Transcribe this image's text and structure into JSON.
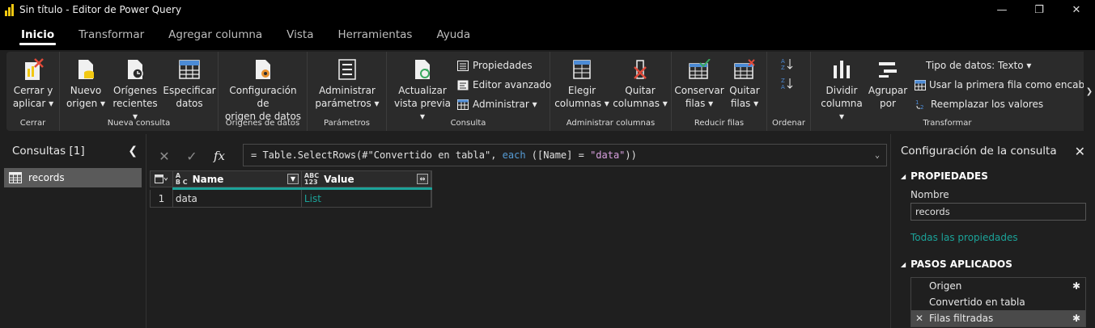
{
  "window": {
    "title": "Sin título - Editor de Power Query",
    "minimize": "—",
    "maximize": "❐",
    "close": "✕"
  },
  "tabs": [
    "Inicio",
    "Transformar",
    "Agregar columna",
    "Vista",
    "Herramientas",
    "Ayuda"
  ],
  "ribbon": {
    "cerrar": {
      "label": "Cerrar y\naplicar ▾",
      "group": "Cerrar"
    },
    "nueva_consulta": {
      "nuevo_origen": "Nuevo\norigen ▾",
      "origenes_recientes": "Orígenes\nrecientes ▾",
      "especificar_datos": "Especificar\ndatos",
      "group": "Nueva consulta"
    },
    "origenes": {
      "config": "Configuración de\norigen de datos",
      "group": "Orígenes de datos"
    },
    "parametros": {
      "admin": "Administrar\nparámetros ▾",
      "group": "Parámetros"
    },
    "consulta": {
      "actualizar": "Actualizar\nvista previa ▾",
      "propiedades": "Propiedades",
      "editor_avanzado": "Editor avanzado",
      "administrar": "Administrar ▾",
      "group": "Consulta"
    },
    "admin_columnas": {
      "elegir": "Elegir\ncolumnas ▾",
      "quitar": "Quitar\ncolumnas ▾",
      "group": "Administrar columnas"
    },
    "reducir_filas": {
      "conservar": "Conservar\nfilas ▾",
      "quitar": "Quitar\nfilas ▾",
      "group": "Reducir filas"
    },
    "ordenar": {
      "group": "Ordenar"
    },
    "transformar": {
      "dividir": "Dividir\ncolumna ▾",
      "agrupar": "Agrupar\npor",
      "tipo_datos": "Tipo de datos: Texto ▾",
      "primera_fila": "Usar la primera fila como encabezados ▾",
      "reemplazar": "Reemplazar los valores",
      "group": "Transformar"
    }
  },
  "queries_pane": {
    "title": "Consultas [1]",
    "items": [
      "records"
    ]
  },
  "formula": {
    "prefix": "= Table.SelectRows(#\"Convertido en tabla\", ",
    "keyword": "each",
    "middle": " ([Name] = ",
    "string": "\"data\"",
    "suffix": "))"
  },
  "grid": {
    "columns": [
      {
        "name": "Name",
        "type_top": "A",
        "type_bottom": "B C"
      },
      {
        "name": "Value",
        "type_top": "ABC",
        "type_bottom": "123"
      }
    ],
    "rows": [
      {
        "index": "1",
        "name": "data",
        "value": "List"
      }
    ]
  },
  "settings_pane": {
    "title": "Configuración de la consulta",
    "properties_header": "PROPIEDADES",
    "name_label": "Nombre",
    "name_value": "records",
    "all_properties": "Todas las propiedades",
    "steps_header": "PASOS APLICADOS",
    "steps": [
      "Origen",
      "Convertido en tabla",
      "Filas filtradas"
    ]
  },
  "colors": {
    "accent": "#1ba399",
    "keyword": "#569cd6",
    "string": "#d8a0df",
    "logo": "#f2c811"
  }
}
